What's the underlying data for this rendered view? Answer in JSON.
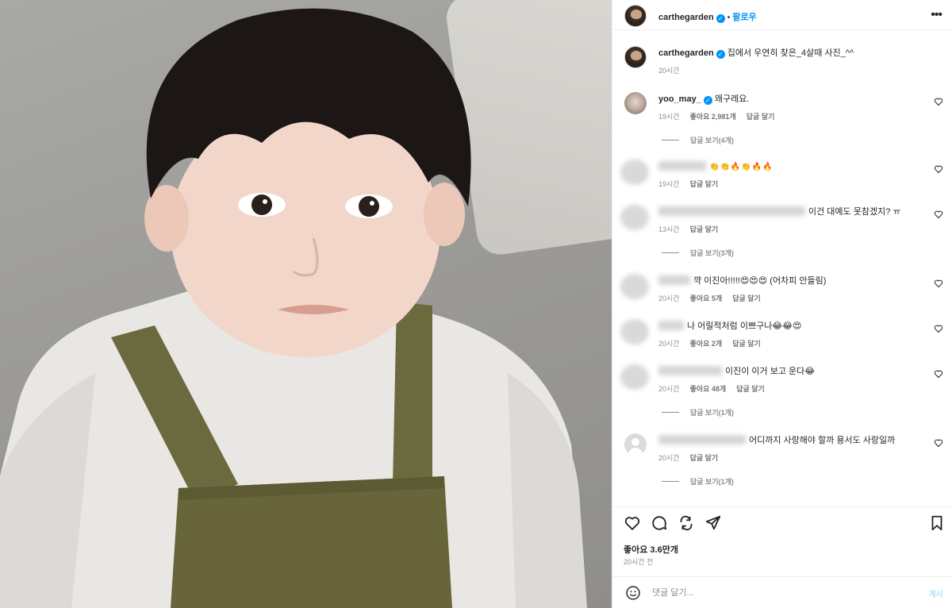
{
  "owner": {
    "username": "carthegarden",
    "follow_label": "팔로우",
    "separator": "•",
    "more_icon": "more-horizontal-icon"
  },
  "caption": {
    "username": "carthegarden",
    "text": "집에서 우연히 찾은_4살때 사진_^^",
    "time": "20시간"
  },
  "comments": [
    {
      "username": "yoo_may_",
      "verified": true,
      "text": "왜구레요.",
      "time": "19시간",
      "likes": "좋아요 2,981개",
      "reply": "답글 달기",
      "view_replies": "답글 보기(4개)"
    },
    {
      "username_hidden": true,
      "text": "👏👏🔥👏🔥🔥",
      "time": "19시간",
      "reply": "답글 달기"
    },
    {
      "username_hidden": true,
      "text": "이건 대예도 못참겠지? ㅠ",
      "time": "13시간",
      "reply": "답글 달기",
      "view_replies": "답글 보기(3개)"
    },
    {
      "username_hidden": true,
      "text": "꺅 이진아!!!!!😍😍😍 (어차피 안들림)",
      "time": "20시간",
      "likes": "좋아요 5개",
      "reply": "답글 달기"
    },
    {
      "username_hidden": true,
      "text": "나 어릴적처럼 이쁘구나😂😂😍",
      "time": "20시간",
      "likes": "좋아요 2개",
      "reply": "답글 달기"
    },
    {
      "username_hidden": true,
      "text": "이진이 이거 보고 운다😂",
      "time": "20시간",
      "likes": "좋아요 48개",
      "reply": "답글 달기",
      "view_replies": "답글 보기(1개)"
    },
    {
      "username_hidden": true,
      "text": "어디까지 사랑해야 할까 용서도 사랑일까",
      "time": "20시간",
      "reply": "답글 달기",
      "view_replies": "답글 보기(1개)"
    }
  ],
  "actions": {
    "like_icon": "heart-icon",
    "comment_icon": "comment-icon",
    "share_icon": "repost-icon",
    "send_icon": "send-icon",
    "save_icon": "bookmark-icon",
    "likes_count": "좋아요 3.6만개",
    "posted_ago": "20시간 전"
  },
  "composer": {
    "placeholder": "댓글 달기...",
    "post_label": "게시"
  },
  "colors": {
    "accent": "#0095f6",
    "muted": "#8e8e8e",
    "text": "#262626",
    "post_disabled": "#b2dffc"
  }
}
